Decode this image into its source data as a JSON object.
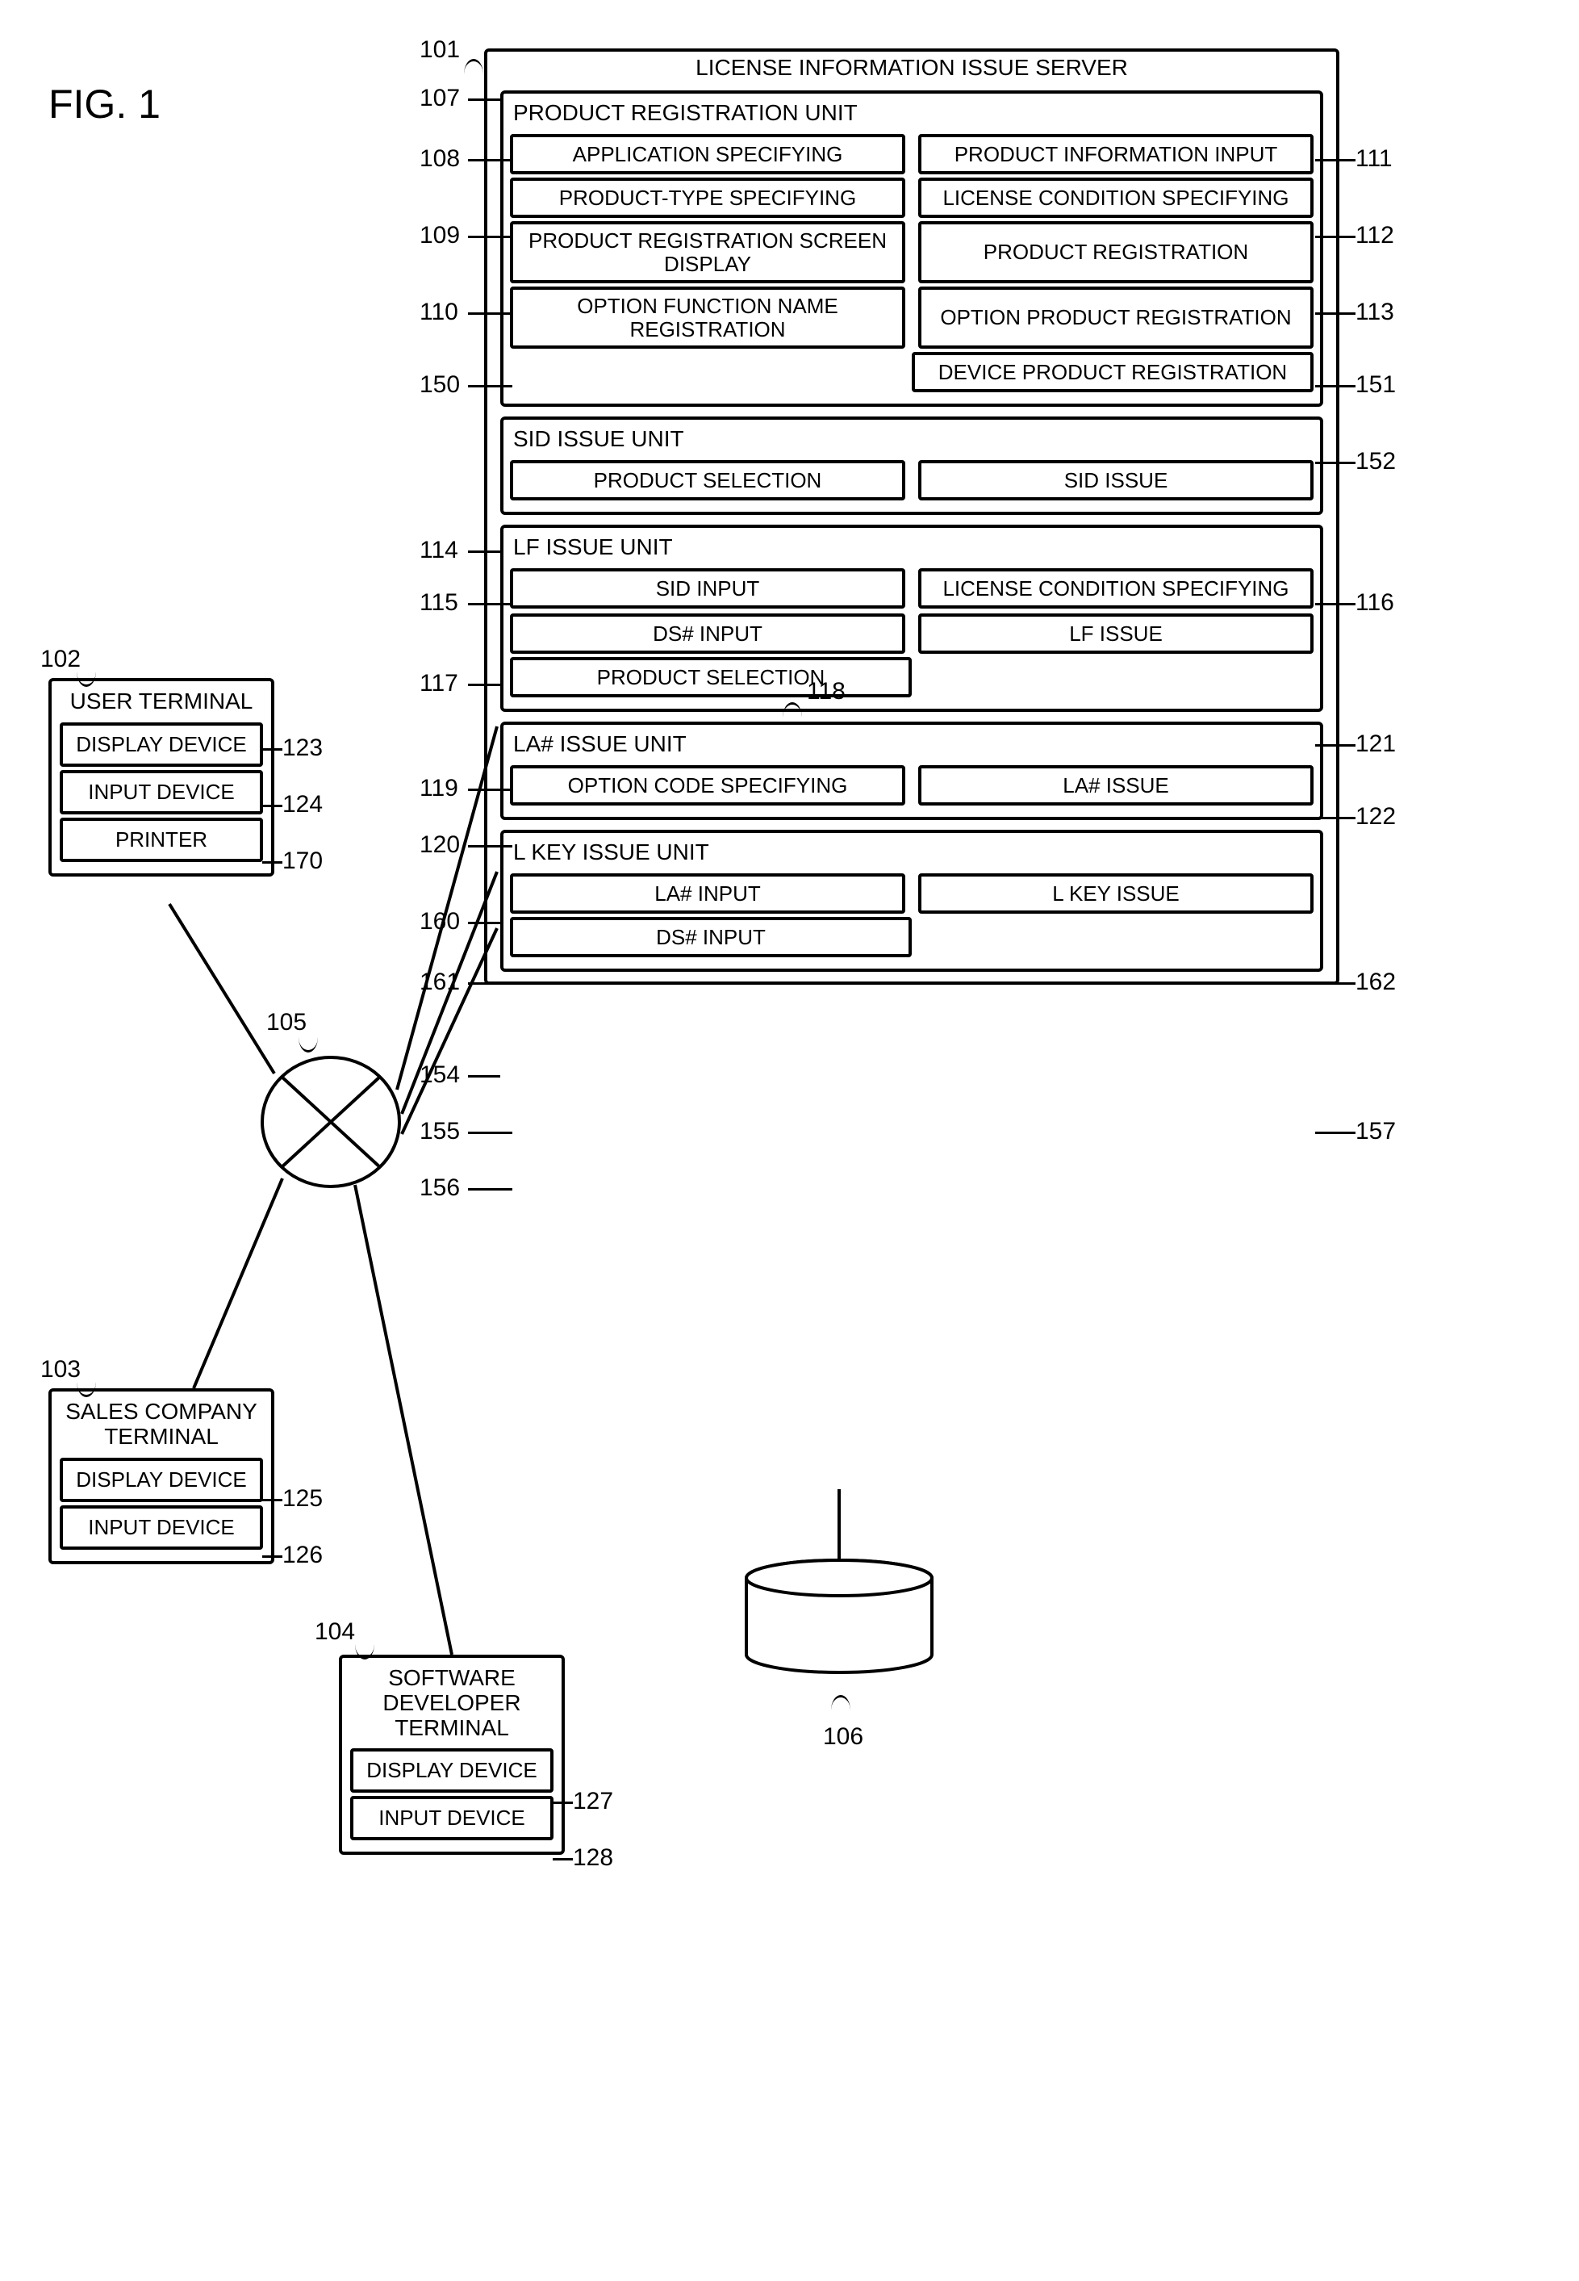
{
  "figure": "FIG. 1",
  "server": {
    "title": "LICENSE INFORMATION ISSUE SERVER",
    "product_reg": {
      "title": "PRODUCT REGISTRATION UNIT",
      "app_spec": "APPLICATION SPECIFYING",
      "prod_info": "PRODUCT INFORMATION INPUT",
      "prod_type": "PRODUCT-TYPE SPECIFYING",
      "lic_cond": "LICENSE CONDITION SPECIFYING",
      "screen_disp": "PRODUCT REGISTRATION SCREEN DISPLAY",
      "prod_reg": "PRODUCT REGISTRATION",
      "opt_name": "OPTION FUNCTION NAME REGISTRATION",
      "opt_prod": "OPTION PRODUCT REGISTRATION",
      "dev_prod": "DEVICE PRODUCT REGISTRATION"
    },
    "sid": {
      "title": "SID ISSUE UNIT",
      "select": "PRODUCT SELECTION",
      "issue": "SID ISSUE"
    },
    "lf": {
      "title": "LF ISSUE UNIT",
      "sid_in": "SID INPUT",
      "lic_cond": "LICENSE CONDITION SPECIFYING",
      "ds_in": "DS# INPUT",
      "lf_issue": "LF ISSUE",
      "prod_sel": "PRODUCT SELECTION"
    },
    "la": {
      "title": "LA# ISSUE UNIT",
      "opt_code": "OPTION CODE SPECIFYING",
      "issue": "LA# ISSUE"
    },
    "lkey": {
      "title": "L KEY ISSUE UNIT",
      "la_in": "LA# INPUT",
      "issue": "L KEY ISSUE",
      "ds_in": "DS# INPUT"
    }
  },
  "user_terminal": {
    "title": "USER TERMINAL",
    "display": "DISPLAY DEVICE",
    "input": "INPUT DEVICE",
    "printer": "PRINTER"
  },
  "sales_terminal": {
    "title": "SALES COMPANY TERMINAL",
    "display": "DISPLAY DEVICE",
    "input": "INPUT DEVICE"
  },
  "dev_terminal": {
    "title": "SOFTWARE DEVELOPER TERMINAL",
    "display": "DISPLAY DEVICE",
    "input": "INPUT DEVICE"
  },
  "refs": {
    "r101": "101",
    "r102": "102",
    "r103": "103",
    "r104": "104",
    "r105": "105",
    "r106": "106",
    "r107": "107",
    "r108": "108",
    "r109": "109",
    "r110": "110",
    "r111": "111",
    "r112": "112",
    "r113": "113",
    "r114": "114",
    "r115": "115",
    "r116": "116",
    "r117": "117",
    "r118": "118",
    "r119": "119",
    "r120": "120",
    "r121": "121",
    "r122": "122",
    "r123": "123",
    "r124": "124",
    "r125": "125",
    "r126": "126",
    "r127": "127",
    "r128": "128",
    "r150": "150",
    "r151": "151",
    "r152": "152",
    "r154": "154",
    "r155": "155",
    "r156": "156",
    "r157": "157",
    "r160": "160",
    "r161": "161",
    "r162": "162",
    "r170": "170"
  }
}
